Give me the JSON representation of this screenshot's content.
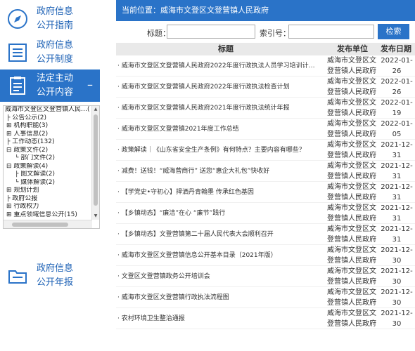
{
  "nav": {
    "items": [
      {
        "line1": "政府信息",
        "line2": "公开指南"
      },
      {
        "line1": "政府信息",
        "line2": "公开制度"
      },
      {
        "line1": "法定主动",
        "line2": "公开内容",
        "toggle": "–"
      },
      {
        "line1": "政府信息",
        "line2": "公开年报"
      }
    ]
  },
  "tree": {
    "lines": [
      {
        "text": "威海市文登区文登营镇人民…(",
        "level": "root"
      },
      {
        "text": "├ 公告公示(2)",
        "level": "lv1"
      },
      {
        "text": "⊞ 机构职能(3)",
        "level": "lv1"
      },
      {
        "text": "⊞ 人事信息(2)",
        "level": "lv1"
      },
      {
        "text": "├ 工作动态(132)",
        "level": "lv1"
      },
      {
        "text": "⊟ 政策文件(2)",
        "level": "lv1"
      },
      {
        "text": "└ 部门文件(2)",
        "level": "lv2"
      },
      {
        "text": "⊟ 政策解读(4)",
        "level": "lv1"
      },
      {
        "text": "├ 图文解读(2)",
        "level": "lv2"
      },
      {
        "text": "└ 媒体解读(2)",
        "level": "lv2"
      },
      {
        "text": "⊞ 规划计划",
        "level": "lv1"
      },
      {
        "text": "├ 政府公报",
        "level": "lv1"
      },
      {
        "text": "⊞ 行政权力",
        "level": "lv1"
      },
      {
        "text": "⊞ 重点领域信息公开(15)",
        "level": "lv1"
      }
    ]
  },
  "header": {
    "breadcrumb": "当前位置：威海市文登区文登营镇人民政府"
  },
  "search": {
    "title_label": "标题：",
    "title_value": "",
    "index_label": "索引号：",
    "index_value": "",
    "button_label": "检索"
  },
  "table": {
    "columns": {
      "title": "标题",
      "unit": "发布单位",
      "date": "发布日期"
    },
    "rows": [
      {
        "title": "· 威海市文登区文登营镇人民政府2022年度行政执法人员学习培训计…",
        "unit": "威海市文登区文登营镇人民政府",
        "date_a": "2022-01-",
        "date_b": "26"
      },
      {
        "title": "· 威海市文登区文登营镇人民政府2022年度行政执法检查计划",
        "unit": "威海市文登区文登营镇人民政府",
        "date_a": "2022-01-",
        "date_b": "26"
      },
      {
        "title": "· 威海市文登区文登营镇人民政府2021年度行政执法统计年报",
        "unit": "威海市文登区文登营镇人民政府",
        "date_a": "2022-01-",
        "date_b": "19"
      },
      {
        "title": "· 威海市文登区文登营镇2021年度工作总结",
        "unit": "威海市文登区文登营镇人民政府",
        "date_a": "2022-01-",
        "date_b": "05"
      },
      {
        "title": "· 政策解读｜《山东省安全生产条例》有何特点？主要内容有哪些？",
        "unit": "威海市文登区文登营镇人民政府",
        "date_a": "2021-12-",
        "date_b": "31"
      },
      {
        "title": "· 减费！送钱！“威海营商行” 送您“惠企大礼包”快收好",
        "unit": "威海市文登区文登营镇人民政府",
        "date_a": "2021-12-",
        "date_b": "31"
      },
      {
        "title": "· 【学党史•守初心】捍洒丹青翰墨 传承红色基因",
        "unit": "威海市文登区文登营镇人民政府",
        "date_a": "2021-12-",
        "date_b": "31"
      },
      {
        "title": "· 【乡镇动态】“廉洁”在心 “廉节”践行",
        "unit": "威海市文登区文登营镇人民政府",
        "date_a": "2021-12-",
        "date_b": "31"
      },
      {
        "title": "· 【乡镇动态】文登营镇第二十届人民代表大会顺利召开",
        "unit": "威海市文登区文登营镇人民政府",
        "date_a": "2021-12-",
        "date_b": "31"
      },
      {
        "title": "· 威海市文登区文登营镇信息公开基本目录（2021年版）",
        "unit": "威海市文登区文登营镇人民政府",
        "date_a": "2021-12-",
        "date_b": "30"
      },
      {
        "title": "· 文登区文登营镇政务公开培训会",
        "unit": "威海市文登区文登营镇人民政府",
        "date_a": "2021-12-",
        "date_b": "30"
      },
      {
        "title": "· 威海市文登区文登营镇行政执法流程图",
        "unit": "威海市文登区文登营镇人民政府",
        "date_a": "2021-12-",
        "date_b": "30"
      },
      {
        "title": "· 农村环境卫生整治通报",
        "unit": "威海市文登区文登营镇人民政府",
        "date_a": "2021-12-",
        "date_b": "30"
      }
    ]
  },
  "colors": {
    "accent": "#2a73c8",
    "header_bg": "#e9e9e9"
  }
}
